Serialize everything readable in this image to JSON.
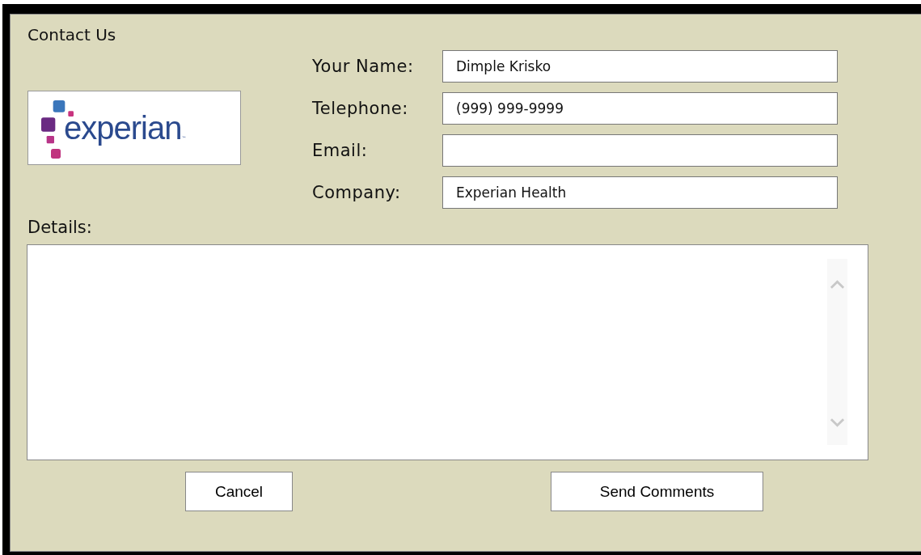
{
  "title": "Contact Us",
  "logo": {
    "text": "experian",
    "mark": "™"
  },
  "fields": [
    {
      "label": "Your Name:",
      "value": "Dimple Krisko"
    },
    {
      "label": "Telephone:",
      "value": "(999) 999-9999"
    },
    {
      "label": "Email:"
    },
    {
      "label": "Company:",
      "value": "Experian Health"
    }
  ],
  "details": {
    "label": "Details:"
  },
  "buttons": [
    {
      "label": "Cancel"
    },
    {
      "label": "Send Comments"
    }
  ]
}
